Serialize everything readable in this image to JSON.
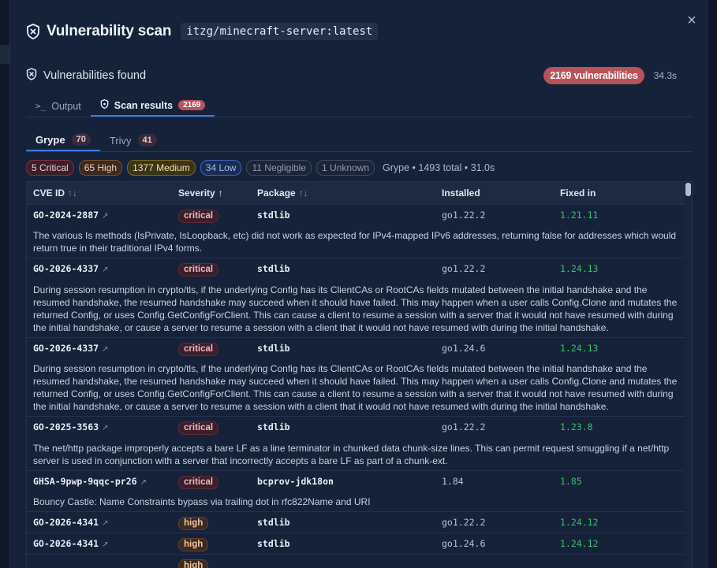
{
  "modal": {
    "title": "Vulnerability scan",
    "image_tag": "itzg/minecraft-server:latest",
    "close_glyph": "×"
  },
  "summary": {
    "label": "Vulnerabilities found",
    "count_text": "2169 vulnerabilities",
    "duration": "34.3s"
  },
  "main_tabs": [
    {
      "label": "Output",
      "icon": "terminal-icon",
      "glyph": ">_"
    },
    {
      "label": "Scan results",
      "icon": "shield-icon",
      "count": "2169"
    }
  ],
  "sub_tabs": [
    {
      "label": "Grype",
      "count": "70"
    },
    {
      "label": "Trivy",
      "count": "41"
    }
  ],
  "filters": {
    "critical": "5 Critical",
    "high": "65 High",
    "medium": "1377 Medium",
    "low": "34 Low",
    "negligible": "11 Negligible",
    "unknown": "1 Unknown",
    "summary": "Grype • 1493 total • 31.0s"
  },
  "table": {
    "headers": {
      "cve": "CVE ID",
      "severity": "Severity",
      "package": "Package",
      "installed": "Installed",
      "fixed": "Fixed in",
      "sort_both": "↑↓",
      "sort_up": "↑"
    },
    "rows": [
      {
        "cve": "GO-2024-2887",
        "severity": "critical",
        "package": "stdlib",
        "installed": "go1.22.2",
        "fixed": "1.21.11",
        "description": "The various Is methods (IsPrivate, IsLoopback, etc) did not work as expected for IPv4-mapped IPv6 addresses, returning false for addresses which would return true in their traditional IPv4 forms."
      },
      {
        "cve": "GO-2026-4337",
        "severity": "critical",
        "package": "stdlib",
        "installed": "go1.22.2",
        "fixed": "1.24.13",
        "description": "During session resumption in crypto/tls, if the underlying Config has its ClientCAs or RootCAs fields mutated between the initial handshake and the resumed handshake, the resumed handshake may succeed when it should have failed. This may happen when a user calls Config.Clone and mutates the returned Config, or uses Config.GetConfigForClient. This can cause a client to resume a session with a server that it would not have resumed with during the initial handshake, or cause a server to resume a session with a client that it would not have resumed with during the initial handshake."
      },
      {
        "cve": "GO-2026-4337",
        "severity": "critical",
        "package": "stdlib",
        "installed": "go1.24.6",
        "fixed": "1.24.13",
        "description": "During session resumption in crypto/tls, if the underlying Config has its ClientCAs or RootCAs fields mutated between the initial handshake and the resumed handshake, the resumed handshake may succeed when it should have failed. This may happen when a user calls Config.Clone and mutates the returned Config, or uses Config.GetConfigForClient. This can cause a client to resume a session with a server that it would not have resumed with during the initial handshake, or cause a server to resume a session with a client that it would not have resumed with during the initial handshake."
      },
      {
        "cve": "GO-2025-3563",
        "severity": "critical",
        "package": "stdlib",
        "installed": "go1.22.2",
        "fixed": "1.23.8",
        "description": "The net/http package improperly accepts a bare LF as a line terminator in chunked data chunk-size lines. This can permit request smuggling if a net/http server is used in conjunction with a server that incorrectly accepts a bare LF as part of a chunk-ext."
      },
      {
        "cve": "GHSA-9pwp-9qqc-pr26",
        "severity": "critical",
        "package": "bcprov-jdk18on",
        "installed": "1.84",
        "fixed": "1.85",
        "description": "Bouncy Castle: Name Constraints bypass via trailing dot in rfc822Name and URI"
      },
      {
        "cve": "GO-2026-4341",
        "severity": "high",
        "package": "stdlib",
        "installed": "go1.22.2",
        "fixed": "1.24.12",
        "description": ""
      },
      {
        "cve": "GO-2026-4341",
        "severity": "high",
        "package": "stdlib",
        "installed": "go1.24.6",
        "fixed": "1.24.12",
        "description": ""
      },
      {
        "cve": "",
        "severity": "high",
        "package": "",
        "installed": "",
        "fixed": "",
        "description": ""
      }
    ]
  },
  "colors": {
    "accent": "#3b7be0",
    "critical_pill": "#b9525a",
    "fixed_green": "#35c06b"
  }
}
